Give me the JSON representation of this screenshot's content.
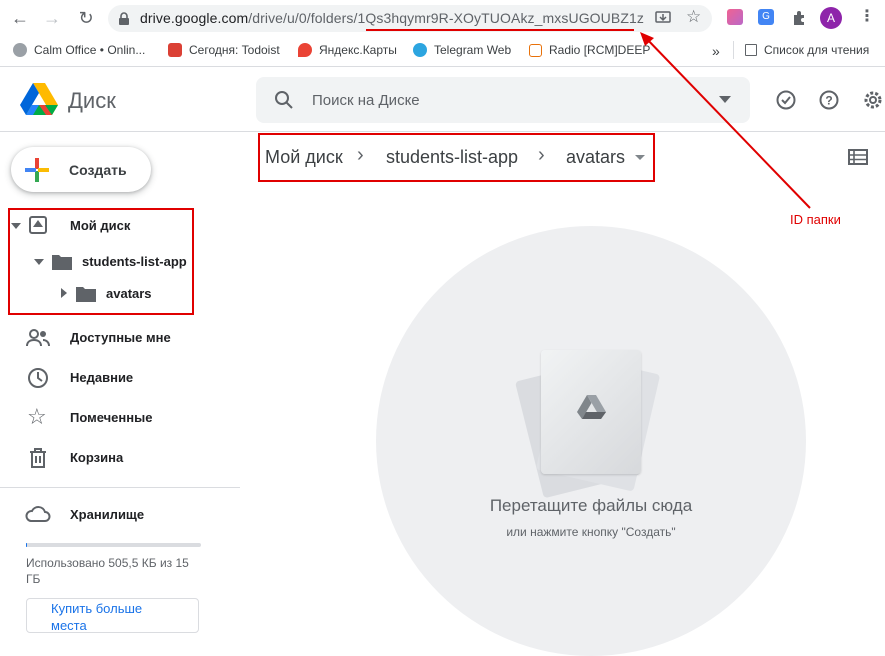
{
  "browser": {
    "url_host": "drive.google.com",
    "url_path": "/drive/u/0/folders/1Qs3hqymr9R-XOyTUOAkz_mxsUGOUBZ1z",
    "profile_initial": "A",
    "bookmarks": [
      {
        "label": "Calm Office • Onlin...",
        "color": "#9aa0a6"
      },
      {
        "label": "Сегодня: Todoist",
        "color": "#db4035"
      },
      {
        "label": "Яндекс.Карты",
        "color": "#ea4335"
      },
      {
        "label": "Telegram Web",
        "color": "#2ca5e0"
      },
      {
        "label": "Radio [RCM]DEEP",
        "color": "#e8710a"
      }
    ],
    "overflow_label": "»",
    "reading_list": "Список для чтения"
  },
  "drive": {
    "logo_text": "Диск",
    "search_placeholder": "Поиск на Диске",
    "create_label": "Создать",
    "tree": {
      "root": "Мой диск",
      "child": "students-list-app",
      "grandchild": "avatars"
    },
    "nav": [
      {
        "label": "Доступные мне",
        "icon": "shared-icon"
      },
      {
        "label": "Недавние",
        "icon": "clock-icon"
      },
      {
        "label": "Помеченные",
        "icon": "star-icon"
      },
      {
        "label": "Корзина",
        "icon": "trash-icon"
      }
    ],
    "storage": {
      "label": "Хранилище",
      "used_text": "Использовано 505,5 КБ из 15 ГБ",
      "used_fraction": 3e-05,
      "buy_label": "Купить больше места"
    },
    "breadcrumb": [
      "Мой диск",
      "students-list-app",
      "avatars"
    ],
    "empty": {
      "title": "Перетащите файлы сюда",
      "subtitle": "или нажмите кнопку \"Создать\""
    }
  },
  "annotation": {
    "label": "ID папки",
    "color": "#e00000"
  }
}
